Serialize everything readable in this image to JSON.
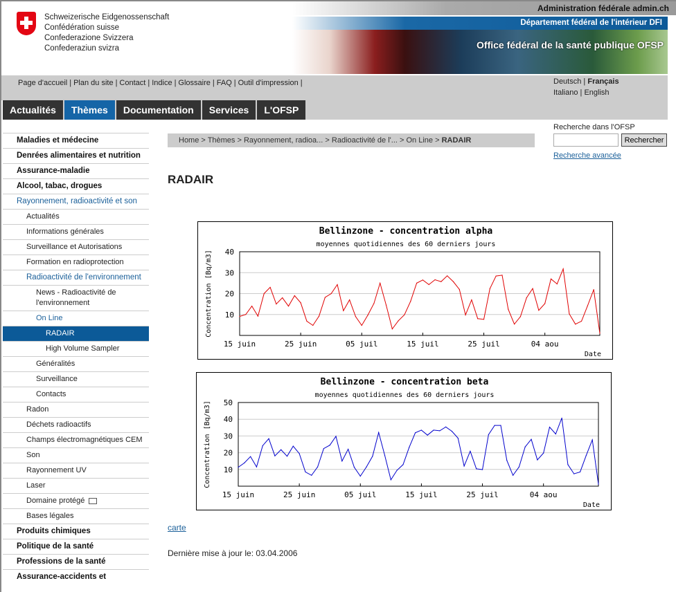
{
  "header": {
    "confederation": [
      "Schweizerische Eidgenossenschaft",
      "Confédération suisse",
      "Confederazione Svizzera",
      "Confederaziun svizra"
    ],
    "admin": "Administration fédérale admin.ch",
    "department": "Département fédéral de l'intérieur DFI",
    "office": "Office fédéral de la santé publique OFSP"
  },
  "util_links": [
    "Page d'accueil",
    "Plan du site",
    "Contact",
    "Indice",
    "Glossaire",
    "FAQ",
    "Outil d'impression"
  ],
  "languages": {
    "de": "Deutsch",
    "fr": "Français",
    "it": "Italiano",
    "en": "English"
  },
  "nav": [
    {
      "label": "Actualités"
    },
    {
      "label": "Thèmes",
      "active": true
    },
    {
      "label": "Documentation"
    },
    {
      "label": "Services"
    },
    {
      "label": "L'OFSP"
    }
  ],
  "sidebar": [
    {
      "label": "Maladies et médecine",
      "level": 0
    },
    {
      "label": "Denrées alimentaires et nutrition",
      "level": 0
    },
    {
      "label": "Assurance-maladie",
      "level": 0
    },
    {
      "label": "Alcool, tabac, drogues",
      "level": 0
    },
    {
      "label": "Rayonnement, radioactivité et son",
      "level": 0,
      "open": true
    },
    {
      "label": "Actualités",
      "level": 1
    },
    {
      "label": "Informations générales",
      "level": 1
    },
    {
      "label": "Surveillance et Autorisations",
      "level": 1
    },
    {
      "label": "Formation en radioprotection",
      "level": 1
    },
    {
      "label": "Radioactivité de l'environnement",
      "level": 1,
      "open": true
    },
    {
      "label": "News - Radioactivité de l'environnement",
      "level": 2
    },
    {
      "label": "On Line",
      "level": 2,
      "open": true
    },
    {
      "label": "RADAIR",
      "level": 3,
      "selected": true
    },
    {
      "label": "High Volume Sampler",
      "level": 3
    },
    {
      "label": "Généralités",
      "level": 2
    },
    {
      "label": "Surveillance",
      "level": 2
    },
    {
      "label": "Contacts",
      "level": 2
    },
    {
      "label": "Radon",
      "level": 1
    },
    {
      "label": "Déchets radioactifs",
      "level": 1
    },
    {
      "label": "Champs électromagnétiques CEM",
      "level": 1
    },
    {
      "label": "Son",
      "level": 1
    },
    {
      "label": "Rayonnement UV",
      "level": 1
    },
    {
      "label": "Laser",
      "level": 1
    },
    {
      "label": "Domaine protégé",
      "level": 1,
      "icon": "key-icon"
    },
    {
      "label": "Bases légales",
      "level": 1
    },
    {
      "label": "Produits chimiques",
      "level": 0
    },
    {
      "label": "Politique de la santé",
      "level": 0
    },
    {
      "label": "Professions de la santé",
      "level": 0
    },
    {
      "label": "Assurance-accidents et",
      "level": 0
    }
  ],
  "breadcrumb": [
    "Home",
    "Thèmes",
    "Rayonnement, radioa...",
    "Radioactivité de l'...",
    "On Line",
    "RADAIR"
  ],
  "search": {
    "label": "Recherche dans l'OFSP",
    "value": "",
    "button": "Rechercher",
    "advanced": "Recherche avancée"
  },
  "page_title": "RADAIR",
  "carte_link": "carte",
  "last_update": "Dernière mise à jour le: 03.04.2006",
  "colors": {
    "accent": "#1565a7",
    "nav_dark": "#333333",
    "alpha_line": "#e00000",
    "beta_line": "#0000cc"
  },
  "chart_data": [
    {
      "type": "line",
      "title": "Bellinzone - concentration alpha",
      "subtitle": "moyennes quotidiennes des 60 derniers jours",
      "xlabel": "Date",
      "ylabel": "Concentration [Bq/m3]",
      "ylim": [
        0,
        40
      ],
      "yticks": [
        10,
        20,
        30,
        40
      ],
      "xtick_labels": [
        "15 juin",
        "25 juin",
        "05 juil",
        "15 juil",
        "25 juil",
        "04 aou"
      ],
      "grid": true,
      "color": "#e00000",
      "values": [
        9.1,
        10,
        14,
        9.2,
        20,
        23,
        15,
        18,
        14,
        19,
        15.6,
        6.8,
        4.8,
        9.2,
        18.2,
        20,
        24.3,
        11.8,
        17,
        9,
        4.8,
        9.7,
        15.3,
        25,
        14.5,
        3.1,
        7,
        9.9,
        16.3,
        25,
        26.5,
        24.3,
        26.6,
        25.7,
        28.5,
        25.7,
        22,
        9.8,
        17,
        8,
        7.7,
        22.4,
        28.4,
        28.8,
        12.5,
        5.4,
        9,
        18,
        22.4,
        12,
        15.2,
        27,
        24.6,
        31.8,
        10.3,
        5.4,
        6.8,
        14.2,
        21.9,
        1
      ]
    },
    {
      "type": "line",
      "title": "Bellinzone - concentration beta",
      "subtitle": "moyennes quotidiennes des 60 derniers jours",
      "xlabel": "Date",
      "ylabel": "Concentration [Bq/m3]",
      "ylim": [
        0,
        50
      ],
      "yticks": [
        10,
        20,
        30,
        40,
        50
      ],
      "xtick_labels": [
        "15 juin",
        "25 juin",
        "05 juil",
        "15 juil",
        "25 juil",
        "04 aou"
      ],
      "grid": true,
      "color": "#0000cc",
      "values": [
        11.3,
        13.9,
        17.7,
        11.5,
        24.2,
        28.4,
        18.1,
        21.8,
        17.9,
        23.9,
        19.5,
        8.5,
        6.5,
        11.5,
        22.5,
        24.5,
        29.8,
        15,
        22.1,
        11.3,
        6,
        11.5,
        17.9,
        32.1,
        18.4,
        3.8,
        9.5,
        12.9,
        23.2,
        31.9,
        33.5,
        30.5,
        33.5,
        33.1,
        35.4,
        32.8,
        28.7,
        12,
        20.9,
        10.4,
        9.9,
        30.8,
        36.3,
        36.3,
        15.4,
        6.5,
        11.5,
        23.5,
        28,
        15.7,
        19.8,
        35.3,
        31.2,
        40.7,
        12.9,
        7.4,
        8.5,
        18.4,
        27.7,
        1.2
      ]
    }
  ]
}
